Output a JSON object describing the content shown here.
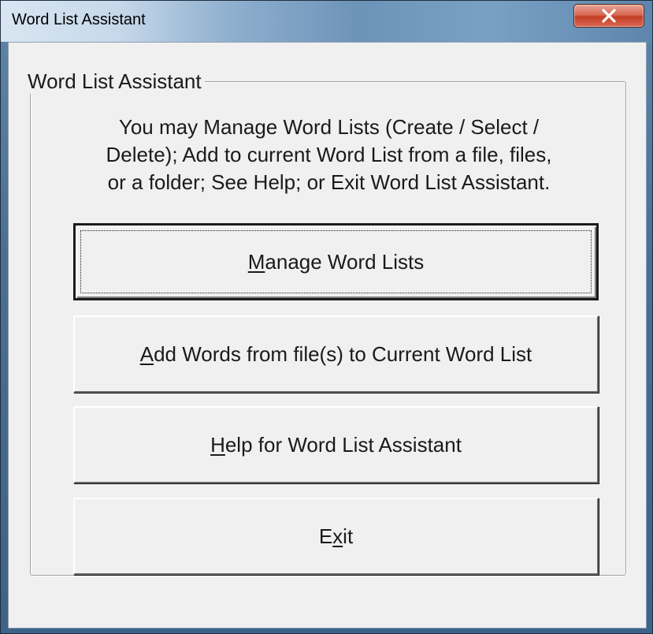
{
  "window": {
    "title": "Word List Assistant",
    "close_icon": "close-icon"
  },
  "group": {
    "legend": "Word List Assistant"
  },
  "description": "You may Manage Word Lists (Create / Select /\nDelete); Add to current Word List from a file, files,\nor a folder;  See Help; or Exit Word List Assistant.",
  "buttons": {
    "manage": {
      "mnemonic": "M",
      "rest": "anage Word Lists"
    },
    "add": {
      "mnemonic": "A",
      "rest": "dd Words from file(s) to Current Word List"
    },
    "help": {
      "mnemonic": "H",
      "rest": "elp for Word List Assistant"
    },
    "exit": {
      "pre": "E",
      "mnemonic": "x",
      "rest": "it"
    }
  }
}
